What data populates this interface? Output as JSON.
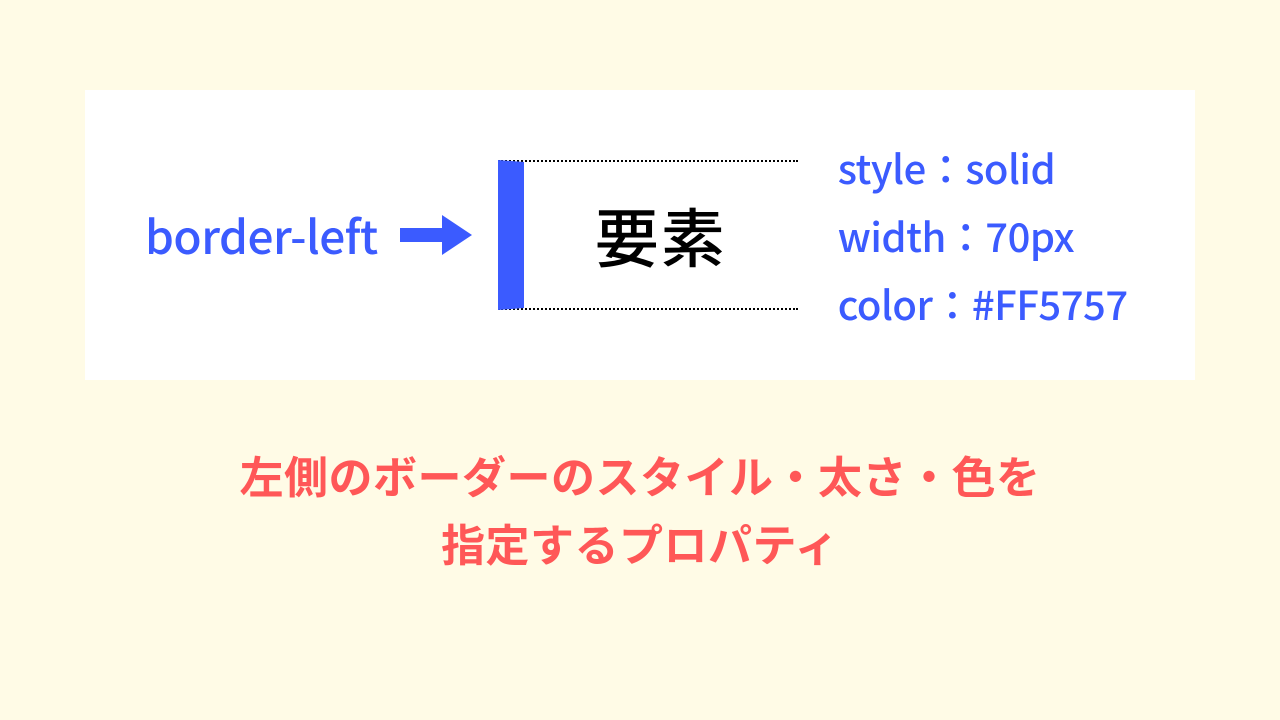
{
  "diagram": {
    "left_label": "border-left",
    "element_label": "要素",
    "props": {
      "style": "style：solid",
      "width": "width：70px",
      "color": "color：#FF5757"
    }
  },
  "caption": {
    "line1": "左側のボーダーのスタイル・太さ・色を",
    "line2": "指定するプロパティ"
  },
  "colors": {
    "accent": "#3B5BFF",
    "caption": "#FF5757",
    "bg": "#FFFBE6"
  }
}
